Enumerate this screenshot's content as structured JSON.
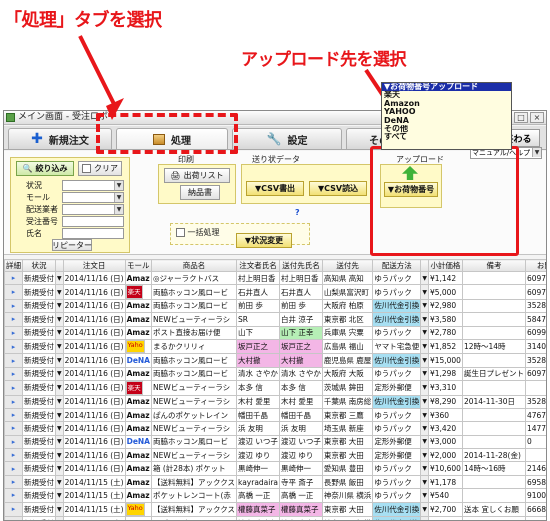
{
  "annotations": {
    "tab_hint": "「処理」タブを選択",
    "dropdown_hint": "アップロード先を選択"
  },
  "colors": {
    "annotation_red": "#e8161a",
    "tab_bg": "#e2e2e2",
    "section_yellow": "#fffac8",
    "dropdown_highlight": "#1b2ea8"
  },
  "window": {
    "title": "メイン画面 - 受注ロボ",
    "btn_minimize": "–",
    "btn_maximize": "□",
    "btn_close": "×"
  },
  "tabs": {
    "new_order": "新規注文",
    "process": "処理",
    "settings": "設定",
    "other": "その他/申込み",
    "end": "終わる"
  },
  "panel": {
    "filter_label": "絞り込み",
    "clear_label": "クリア",
    "status_label": "状況",
    "mall_label": "モール",
    "carrier_label": "配送業者",
    "order_no_label": "受注番号",
    "name_label": "氏名",
    "repeater_label": "リピーター",
    "print_label": "印刷",
    "shipping_list_label": "出荷リスト",
    "delivery_note_label": "納品書",
    "send_data_label": "送り状データ",
    "out_csv_label": "▼CSV書出",
    "in_csv_label": "▼CSV読込",
    "help_mark": "?",
    "bulk_process_label": "一括処理",
    "status_change_label": "▼状況変更",
    "upload_label": "アップロード",
    "upload_select": "▼お荷物番号",
    "manual_link": "マニュアル/ヘルプ"
  },
  "upload_options": [
    "▼お荷物番号アップロード",
    "楽天",
    "Amazon",
    "YAHOO",
    "DeNA",
    "その他",
    "すべて"
  ],
  "grid": {
    "headers": [
      "詳細",
      "状況",
      "",
      "注文日",
      "モール",
      "商品名",
      "注文者氏名",
      "送付先氏名",
      "送付先",
      "配送方法",
      "",
      "小計価格",
      "備考",
      "お問合番号",
      ""
    ],
    "rows": [
      {
        "status": "新規受付",
        "date": "2014/11/16 (日)",
        "mall": "Amaz",
        "product": "◎ジャーラクトバス",
        "orderer": "村上明日香",
        "recipient": "村上明日香",
        "dest": "高知県 高知",
        "method": "ゆうパック",
        "subtotal": "¥1,142",
        "note": "",
        "inquiry": "609726769071"
      },
      {
        "status": "新規受付",
        "date": "2014/11/16 (日)",
        "mall": "楽天",
        "product": "両脇ホッコン風ロービ",
        "orderer": "石井直人",
        "recipient": "石井直人",
        "dest": "山梨県富沢町",
        "method": "ゆうパック",
        "subtotal": "¥5,000",
        "note": "",
        "inquiry": "609726769646"
      },
      {
        "status": "新規受付",
        "date": "2014/11/16 (日)",
        "mall": "Amaz",
        "product": "両脇ホッコン風ロービ",
        "orderer": "前田 歩",
        "recipient": "前田 歩",
        "dest": "大阪府 柏原",
        "method": "佐川代金引換",
        "subtotal": "¥2,980",
        "note": "",
        "inquiry": "352808830993"
      },
      {
        "status": "新規受付",
        "date": "2014/11/16 (日)",
        "mall": "Amaz",
        "product": "NEWビューティーラシ",
        "orderer": "SR",
        "recipient": "白井 涼子",
        "dest": "東京都 北区",
        "method": "佐川代金引換",
        "subtotal": "¥3,580",
        "note": "",
        "inquiry": "584726769023"
      },
      {
        "status": "新規受付",
        "date": "2014/11/16 (日)",
        "mall": "Amaz",
        "product": "ポスト直接お届け便",
        "orderer": "山下",
        "recipient": "山下 正幸",
        "dest": "兵庫県 宍粟",
        "method": "ゆうパック",
        "subtotal": "¥2,780",
        "note": "",
        "inquiry": "609957659998"
      },
      {
        "status": "新規受付",
        "date": "2014/11/16 (日)",
        "mall": "Yaho",
        "product": "まるかクリリィ",
        "orderer": "坂戸正之",
        "recipient": "坂戸正之",
        "dest": "広島県 福山",
        "method": "ヤマト宅急便",
        "subtotal": "¥1,852",
        "note": "12時〜14時",
        "inquiry": "314009164280"
      },
      {
        "status": "新規受付",
        "date": "2014/11/16 (日)",
        "mall": "DeNA",
        "product": "両脇ホッコン風ロービ",
        "orderer": "大村撤",
        "recipient": "大村撤",
        "dest": "鹿児島県 鹿屋",
        "method": "佐川代金引換",
        "subtotal": "¥15,000",
        "note": "",
        "inquiry": "352808838547"
      },
      {
        "status": "新規受付",
        "date": "2014/11/16 (日)",
        "mall": "Amaz",
        "product": "両脇ホッコン風ロービ",
        "orderer": "清水 さやか",
        "recipient": "清水 さやか",
        "dest": "大阪府 大阪",
        "method": "ゆうパック",
        "subtotal": "¥1,298",
        "note": "誕生日プレゼント",
        "inquiry": "609726769782"
      },
      {
        "status": "新規受付",
        "date": "2014/11/16 (日)",
        "mall": "楽天",
        "product": "NEWビューティーラシ",
        "orderer": "本多 信",
        "recipient": "本多 信",
        "dest": "茨城県 鉾田",
        "method": "定形外郵便",
        "subtotal": "¥3,310",
        "note": "",
        "inquiry": ""
      },
      {
        "status": "新規受付",
        "date": "2014/11/16 (日)",
        "mall": "Amaz",
        "product": "NEWビューティーラシ",
        "orderer": "木村 愛里",
        "recipient": "木村 愛里",
        "dest": "千葉県 南房総",
        "method": "佐川代金引換",
        "subtotal": "¥8,290",
        "note": "2014-11-30日",
        "inquiry": "352808838471"
      },
      {
        "status": "新規受付",
        "date": "2014/11/16 (日)",
        "mall": "Amaz",
        "product": "ぱんのポケットレイン",
        "orderer": "幡田千晶",
        "recipient": "幡田千晶",
        "dest": "東京都 三鷹",
        "method": "ゆうパック",
        "subtotal": "¥360",
        "note": "",
        "inquiry": "476726779546"
      },
      {
        "status": "新規受付",
        "date": "2014/11/16 (日)",
        "mall": "Amaz",
        "product": "NEWビューティーラシ",
        "orderer": "浜 友明",
        "recipient": "浜 友明",
        "dest": "埼玉県 新座",
        "method": "ゆうパック",
        "subtotal": "¥3,420",
        "note": "",
        "inquiry": "147726769329"
      },
      {
        "status": "新規受付",
        "date": "2014/11/16 (日)",
        "mall": "DeNA",
        "product": "両脇ホッコン風ロービ",
        "orderer": "渡辺 いつ子",
        "recipient": "渡辺 いつ子",
        "dest": "東京都 大田",
        "method": "定形外郵便",
        "subtotal": "¥3,000",
        "note": "",
        "inquiry": "0"
      },
      {
        "status": "新規受付",
        "date": "2014/11/16 (日)",
        "mall": "Amaz",
        "product": "NEWビューティーラシ",
        "orderer": "渡辺 ゆり",
        "recipient": "渡辺 ゆり",
        "dest": "東京都 大田",
        "method": "定形外郵便",
        "subtotal": "¥2,000",
        "note": "2014-11-28(金)",
        "inquiry": ""
      },
      {
        "status": "新規受付",
        "date": "2014/11/16 (日)",
        "mall": "Amaz",
        "product": "箱 (計28本) ポケット",
        "orderer": "黒崎伸一",
        "recipient": "黒崎伸一",
        "dest": "愛知県 豊田",
        "method": "ゆうパック",
        "subtotal": "¥10,600",
        "note": "14時〜16時",
        "inquiry": "214628758344"
      },
      {
        "status": "新規受付",
        "date": "2014/11/15 (土)",
        "mall": "Amaz",
        "product": "【送料無料】アッククス",
        "orderer": "kayradaira",
        "recipient": "寺平 斎子",
        "dest": "長野県 飯田",
        "method": "ゆうパック",
        "subtotal": "¥1,178",
        "note": "",
        "inquiry": "695826745800"
      },
      {
        "status": "新規受付",
        "date": "2014/11/15 (土)",
        "mall": "Amaz",
        "product": "ポケットレンコート(赤",
        "orderer": "高橋 一正",
        "recipient": "高橋 一正",
        "dest": "神奈川県 横浜",
        "method": "ゆうパック",
        "subtotal": "¥540",
        "note": "",
        "inquiry": "910025799389"
      },
      {
        "status": "新規受付",
        "date": "2014/11/15 (土)",
        "mall": "Yaho",
        "product": "【送料無料】アッククス",
        "orderer": "權藤真菜子",
        "recipient": "權藤真菜子",
        "dest": "東京都 大田",
        "method": "佐川代金引換",
        "subtotal": "¥2,700",
        "note": "送本 宜しくお願",
        "inquiry": "666808839111"
      },
      {
        "status": "新規受付",
        "date": "2014/11/15 (土)",
        "mall": "Amaz",
        "product": "スプレー容器 100mL 1",
        "orderer": "池上 大志朗",
        "recipient": "池上 大志朗",
        "dest": "神奈川県 相模",
        "method": "佐川代金引換",
        "subtotal": "¥3,960",
        "note": "",
        "inquiry": "845608830410"
      },
      {
        "status": "新規受付",
        "date": "2014/11/15 (土)",
        "mall": "Amaz",
        "product": "アーデアポケットレイ",
        "orderer": "入江 葵",
        "recipient": "入江 葵",
        "dest": "神奈川県 横浜",
        "method": "ゆうパック",
        "subtotal": "¥480",
        "note": "",
        "inquiry": "370726766090"
      }
    ]
  }
}
